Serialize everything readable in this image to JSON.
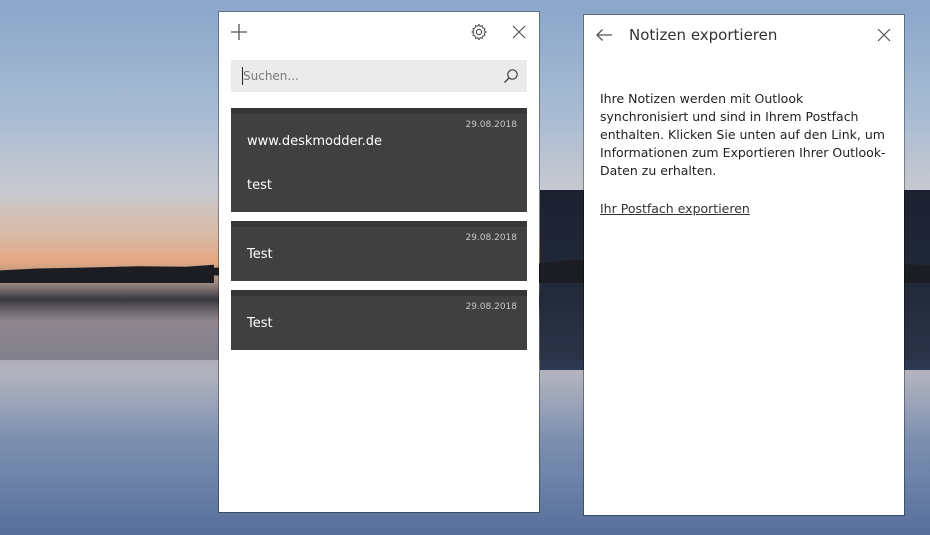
{
  "notes_panel": {
    "search": {
      "placeholder": "Suchen..."
    },
    "cards": [
      {
        "date": "29.08.2018",
        "lines": [
          "www.deskmodder.de",
          "test"
        ]
      },
      {
        "date": "29.08.2018",
        "lines": [
          "Test"
        ]
      },
      {
        "date": "29.08.2018",
        "lines": [
          "Test"
        ]
      }
    ]
  },
  "export_panel": {
    "title": "Notizen exportieren",
    "body": "Ihre Notizen werden mit Outlook synchronisiert und sind in Ihrem Postfach enthalten. Klicken Sie unten auf den Link, um Informationen zum Exportieren Ihrer Outlook-Daten zu erhalten.",
    "link": "Ihr Postfach exportieren"
  },
  "colors": {
    "card_background": "#404040",
    "panel_background": "#ffffff",
    "search_background": "#ebebeb"
  },
  "icons": [
    "plus-icon",
    "gear-icon",
    "close-icon",
    "search-icon",
    "back-arrow-icon"
  ]
}
